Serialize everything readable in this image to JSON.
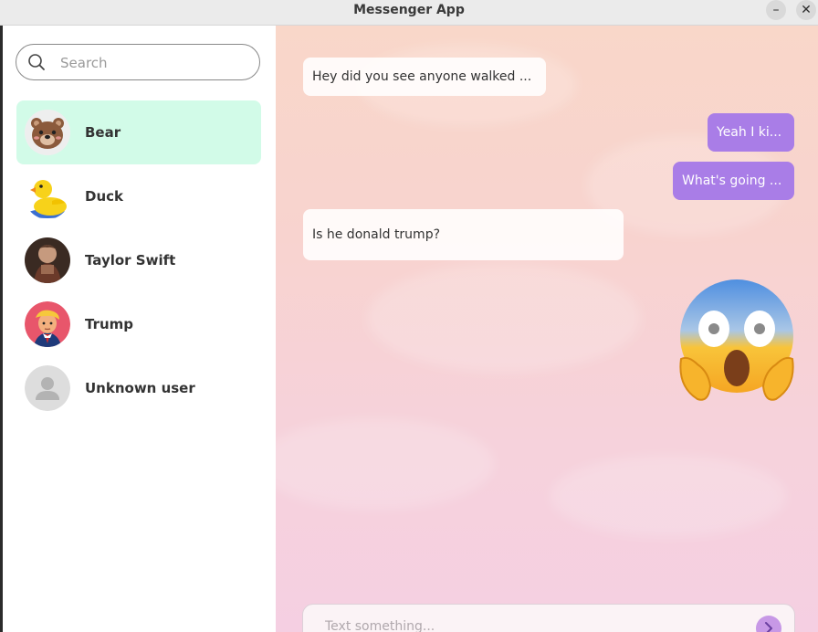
{
  "window": {
    "title": "Messenger App",
    "minimize": "–",
    "close": "✕"
  },
  "sidebar": {
    "search": {
      "placeholder": "Search",
      "value": ""
    },
    "contacts": [
      {
        "name": "Bear",
        "avatar": "bear-avatar",
        "active": true
      },
      {
        "name": "Duck",
        "avatar": "duck-avatar",
        "active": false
      },
      {
        "name": "Taylor Swift",
        "avatar": "photo-avatar",
        "active": false
      },
      {
        "name": "Trump",
        "avatar": "cartoon-avatar",
        "active": false
      },
      {
        "name": "Unknown user",
        "avatar": "default-user-avatar",
        "active": false
      }
    ]
  },
  "chat": {
    "messages": [
      {
        "direction": "in",
        "text": "Hey did you see anyone walked ..."
      },
      {
        "direction": "out",
        "text": "Yeah I ki..."
      },
      {
        "direction": "out",
        "text": "What's going ..."
      },
      {
        "direction": "in",
        "text": "Is he donald trump?"
      },
      {
        "direction": "out",
        "type": "emoji",
        "emoji": "screaming-face-emoji"
      }
    ],
    "composer": {
      "placeholder": "Text something...",
      "value": "",
      "send_icon": "chevron-right-icon"
    }
  },
  "colors": {
    "active_contact": "#d2fbe8",
    "outgoing_bubble": "#a97de7",
    "incoming_bubble": "#ffffff",
    "send_button": "#c798e6"
  }
}
